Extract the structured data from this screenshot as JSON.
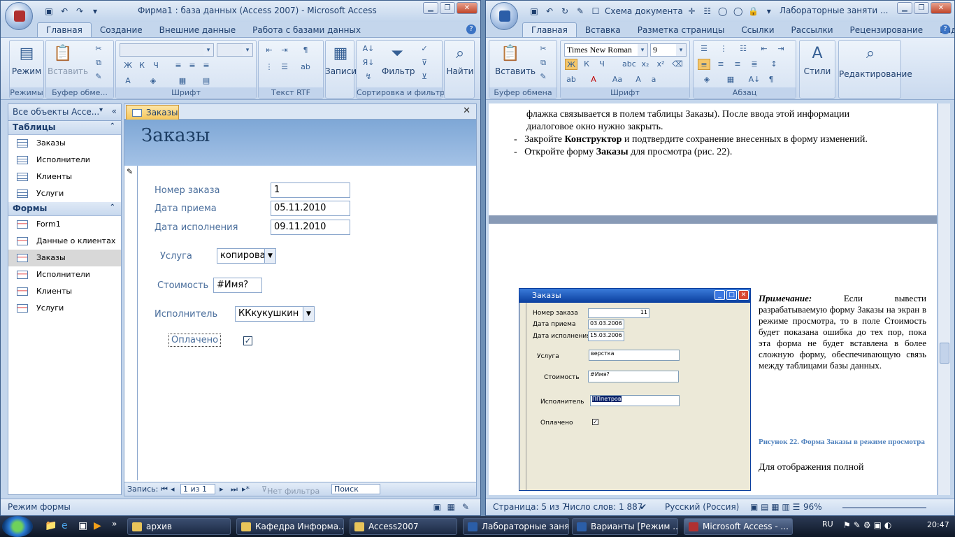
{
  "access": {
    "title": "Фирма1 : база данных (Access 2007) - Microsoft Access",
    "tabs": [
      "Главная",
      "Создание",
      "Внешние данные",
      "Работа с базами данных"
    ],
    "ribbon": {
      "mode_btn": "Режим",
      "paste_btn": "Вставить",
      "records_btn": "Записи",
      "filter_btn": "Фильтр",
      "find_btn": "Найти",
      "groups": [
        "Режимы",
        "Буфер обме...",
        "Шрифт",
        "Текст RTF",
        "Сортировка и фильтр"
      ]
    },
    "nav": {
      "header": "Все объекты Acce...",
      "tables_title": "Таблицы",
      "tables": [
        "Заказы",
        "Исполнители",
        "Клиенты",
        "Услуги"
      ],
      "forms_title": "Формы",
      "forms": [
        "Form1",
        "Данные о клиентах",
        "Заказы",
        "Исполнители",
        "Клиенты",
        "Услуги"
      ]
    },
    "form": {
      "tab": "Заказы",
      "header": "Заказы",
      "order_no_label": "Номер заказа",
      "order_no_value": "1",
      "received_label": "Дата приема",
      "received_value": "05.11.2010",
      "done_label": "Дата исполнения",
      "done_value": "09.11.2010",
      "service_label": "Услуга",
      "service_value": "копирован",
      "cost_label": "Стоимость",
      "cost_value": "#Имя?",
      "executor_label": "Исполнитель",
      "executor_value": "ККкукушкин",
      "paid_label": "Оплачено",
      "paid_checked": true
    },
    "recbar": {
      "label": "Запись:",
      "position": "1 из 1",
      "nofilter": "Нет фильтра",
      "search": "Поиск"
    },
    "status": "Режим формы"
  },
  "word": {
    "title": "Лабораторные заняти ...",
    "qat_schema": "Схема документа",
    "tabs": [
      "Главная",
      "Вставка",
      "Разметка страницы",
      "Ссылки",
      "Рассылки",
      "Рецензирование",
      "Вид"
    ],
    "font": "Times New Roman",
    "size": "9",
    "ribbon": {
      "paste_btn": "Вставить",
      "styles_btn": "Стили",
      "edit_btn": "Редактирование",
      "groups": [
        "Буфер обмена",
        "Шрифт",
        "Абзац"
      ]
    },
    "page1": {
      "line1": "флажка связывается в полем таблицы Заказы). После ввода этой информации",
      "line2": "диалоговое окно нужно закрыть.",
      "bullet1_a": "Закройте ",
      "bullet1_b": "Конструктор",
      "bullet1_c": " и подтвердите сохранение внесенных в форму изменений.",
      "bullet2_a": "Откройте форму ",
      "bullet2_b": "Заказы",
      "bullet2_c": " для просмотра (рис. 22)."
    },
    "figure": {
      "title": "Заказы",
      "order_no_label": "Номер заказа",
      "order_no_value": "11",
      "received_label": "Дата приема",
      "received_value": "03.03.2006",
      "done_label": "Дата исполнения",
      "done_value": "15.03.2006",
      "service_label": "Услуга",
      "service_value": "верстка",
      "cost_label": "Стоимость",
      "cost_value": "#Имя?",
      "executor_label": "Исполнитель",
      "executor_value": "ППпетров",
      "paid_label": "Оплачено"
    },
    "note": {
      "head": "Примечание:",
      "text": "Если вывести разрабатываемую форму Заказы на экран в режиме просмотра, то в поле Стоимость будет показана ошибка до тех пор, пока эта форма не будет вставлена в более сложную форму, обеспечивающую связь между таблицами базы данных."
    },
    "caption": "Рисунок 22. Форма Заказы в режиме просмотра",
    "cut_text": "Для отображения полной",
    "status": {
      "page": "Страница: 5 из 7",
      "words": "Число слов: 1 887",
      "lang": "Русский (Россия)",
      "zoom": "96%"
    }
  },
  "taskbar": {
    "items": [
      "архив",
      "Кафедра Информа...",
      "Access2007",
      "Лабораторные заня...",
      "Варианты [Режим ...",
      "Microsoft Access - ..."
    ],
    "lang": "RU",
    "time": "20:47"
  }
}
